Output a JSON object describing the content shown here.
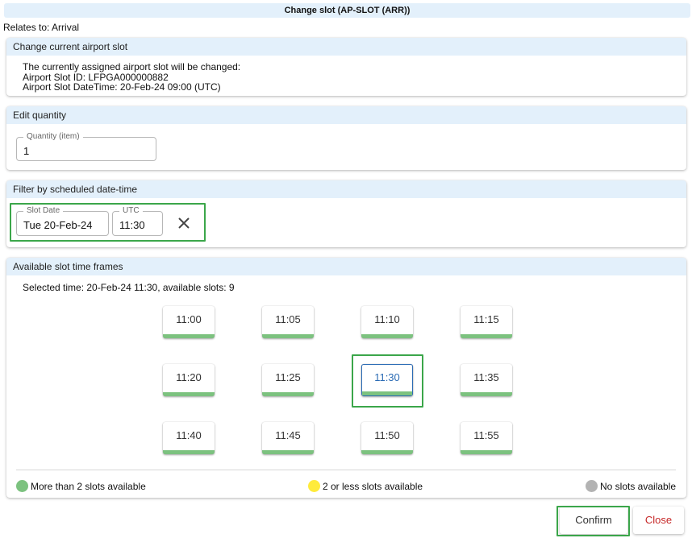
{
  "dialog": {
    "title": "Change slot (AP-SLOT (ARR))",
    "relates_to": "Relates to: Arrival"
  },
  "change_section": {
    "header": "Change current airport slot",
    "line1": "The currently assigned airport slot will be changed:",
    "line2": "Airport Slot ID: LFPGA000000882",
    "line3": "Airport Slot DateTime: 20-Feb-24 09:00 (UTC)"
  },
  "quantity_section": {
    "header": "Edit quantity",
    "label": "Quantity (item)",
    "value": "1"
  },
  "filter_section": {
    "header": "Filter by scheduled date-time",
    "date_label": "Slot Date",
    "date_value": "Tue 20-Feb-24",
    "time_label": "UTC",
    "time_value": "11:30",
    "clear_icon": "close-icon"
  },
  "slots_section": {
    "header": "Available slot time frames",
    "selected_text": "Selected time: 20-Feb-24 11:30, available slots: 9",
    "slots": [
      "11:00",
      "11:05",
      "11:10",
      "11:15",
      "11:20",
      "11:25",
      "11:30",
      "11:35",
      "11:40",
      "11:45",
      "11:50",
      "11:55"
    ],
    "selected_slot": "11:30",
    "legend": {
      "green": "More than 2 slots available",
      "yellow": "2 or less slots available",
      "grey": "No slots available"
    }
  },
  "colors": {
    "available_green": "#7cc27f",
    "few_yellow": "#ffeb3b",
    "none_grey": "#b3b3b3",
    "header_blue": "#e3f0fb",
    "highlight_green": "#3ba64a",
    "selected_blue": "#2c6cb5",
    "close_red": "#c62828"
  },
  "footer": {
    "confirm_label": "Confirm",
    "close_label": "Close"
  }
}
